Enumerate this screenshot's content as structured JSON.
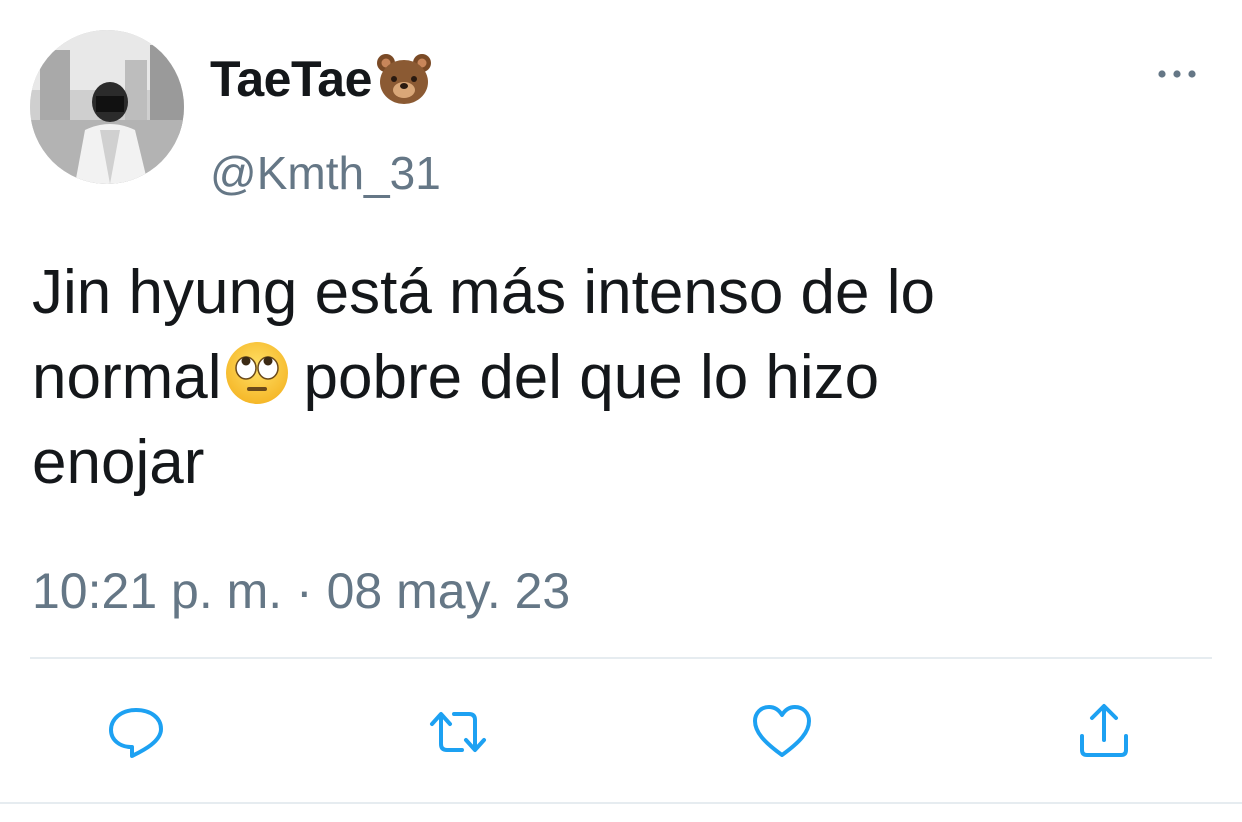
{
  "tweet": {
    "display_name": "TaeTae",
    "display_name_emoji": "bear-face-emoji",
    "handle": "@Kmth_31",
    "body_line1": "Jin hyung está más intenso de lo",
    "body_line2_before": "normal",
    "body_emoji": "face-with-rolling-eyes-emoji",
    "body_line2_after": "pobre del que lo hizo",
    "body_line3": "enojar",
    "timestamp": "10:21 p. m. · 08 may. 23"
  },
  "actions": [
    {
      "icon": "reply-icon"
    },
    {
      "icon": "retweet-icon"
    },
    {
      "icon": "like-icon"
    },
    {
      "icon": "share-icon"
    }
  ],
  "colors": {
    "text": "#14171a",
    "secondary": "#657786",
    "icon": "#1da1f2",
    "divider": "#e6ecf0"
  }
}
